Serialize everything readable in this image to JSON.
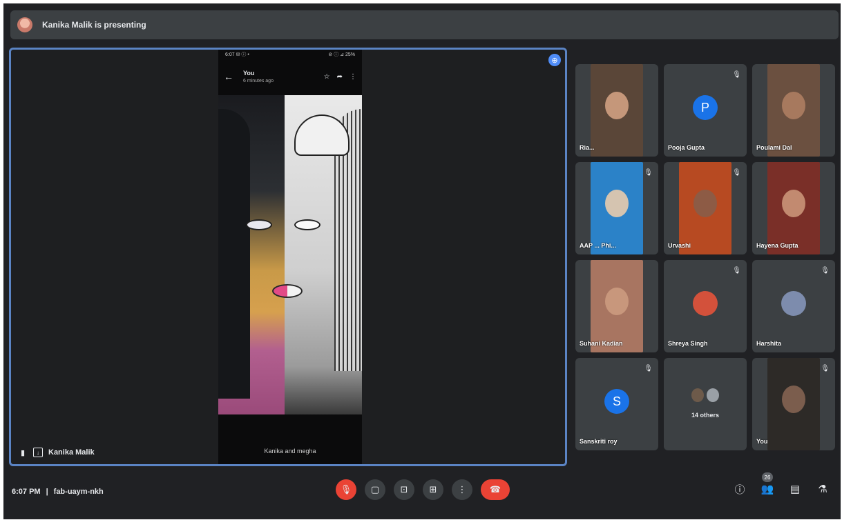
{
  "banner": {
    "text": "Kanika Malik is presenting"
  },
  "phone": {
    "status_left": "6:07 ✉ ⓘ •",
    "status_right": "⊘ ⓘ ⊿ 25%",
    "title": "You",
    "subtitle": "6 minutes ago",
    "caption": "Kanika and megha"
  },
  "presenter": {
    "name": "Kanika Malik"
  },
  "participants": [
    {
      "name": "Ria...",
      "type": "video",
      "muted": false,
      "bg": "#5a4638",
      "face": "#c5977a"
    },
    {
      "name": "Pooja Gupta",
      "type": "initial",
      "initial": "P",
      "color": "#1a73e8",
      "muted": true
    },
    {
      "name": "Poulami Dal",
      "type": "video",
      "muted": false,
      "bg": "#6b5040",
      "face": "#a7795e"
    },
    {
      "name": "AAP ... Phi...",
      "type": "video",
      "muted": true,
      "bg": "#2b82c8",
      "face": "#d5c4b0"
    },
    {
      "name": "Urvashi",
      "type": "video",
      "muted": true,
      "bg": "#b74a22",
      "face": "#8d5b45"
    },
    {
      "name": "Hayena Gupta",
      "type": "video",
      "muted": false,
      "bg": "#7a2f28",
      "face": "#c28a70"
    },
    {
      "name": "Suhani Kadian",
      "type": "video",
      "muted": false,
      "bg": "#a87561",
      "face": "#c8977c"
    },
    {
      "name": "Shreya Singh",
      "type": "initial",
      "initial": "",
      "color": "#d3513b",
      "muted": true
    },
    {
      "name": "Harshita",
      "type": "initial",
      "initial": "",
      "color": "#7d8cad",
      "muted": true
    },
    {
      "name": "Sanskriti roy",
      "type": "initial",
      "initial": "S",
      "color": "#1a73e8",
      "muted": true
    },
    {
      "name": "14 others",
      "type": "others",
      "muted": false
    },
    {
      "name": "You",
      "type": "video",
      "muted": true,
      "bg": "#2d2a27",
      "face": "#7b5d4d"
    }
  ],
  "footer": {
    "time": "6:07 PM",
    "separator": "|",
    "meeting_code": "fab-uaym-nkh",
    "people_count": "26"
  },
  "icons": {
    "mic_off": "🎙",
    "camera_off": "▢",
    "captions": "⊡",
    "present": "⊞",
    "more": "⋮",
    "hangup": "☎",
    "info": "ⓘ",
    "people": "👥",
    "chat": "▤",
    "activities": "⚗"
  },
  "accent": "#5b84c4"
}
